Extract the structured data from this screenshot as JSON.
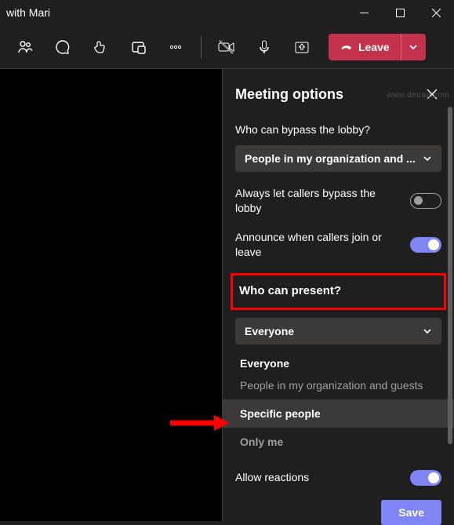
{
  "titlebar": {
    "title": "with Mari"
  },
  "toolbar": {
    "leave_label": "Leave"
  },
  "panel": {
    "title": "Meeting options",
    "bypass_label": "Who can bypass the lobby?",
    "bypass_value": "People in my organization and ...",
    "always_let_label": "Always let callers bypass the lobby",
    "announce_label": "Announce when callers join or leave",
    "present_label": "Who can present?",
    "present_value": "Everyone",
    "options": {
      "everyone": "Everyone",
      "everyone_sub": "People in my organization and guests",
      "specific": "Specific people",
      "only_me": "Only me"
    },
    "reactions_label": "Allow reactions",
    "save_label": "Save"
  },
  "toggles": {
    "always_let": false,
    "announce": true,
    "reactions": true
  },
  "watermark": "www.deuag.com"
}
